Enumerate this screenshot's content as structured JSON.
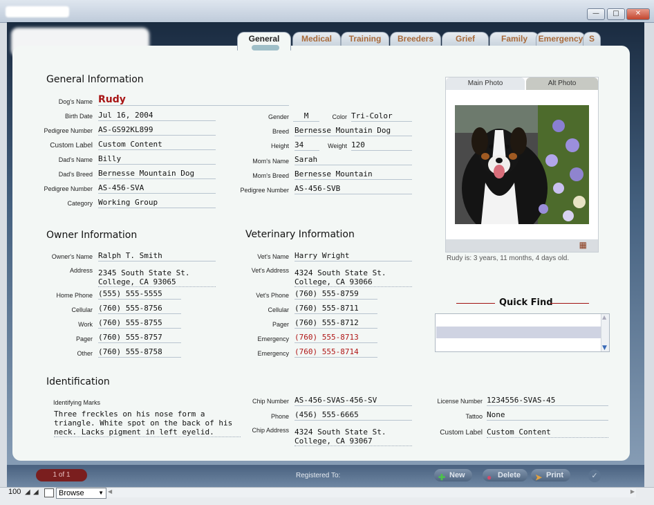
{
  "tabs": [
    "General",
    "Medical",
    "Training",
    "Breeders",
    "Grief",
    "Family",
    "Emergency",
    "S"
  ],
  "general": {
    "title": "General Information",
    "dog_name_label": "Dog's Name",
    "dog_name": "Rudy",
    "birth_date_label": "Birth Date",
    "birth_date": "Jul 16, 2004",
    "pedigree_label": "Pedigree Number",
    "pedigree": "AS-GS92KL899",
    "custom_label_label": "Custom Label",
    "custom_label": "Custom Content",
    "dads_name_label": "Dad's Name",
    "dads_name": "Billy",
    "dads_breed_label": "Dad's Breed",
    "dads_breed": "Bernesse Mountain Dog",
    "dad_pedigree_label": "Pedigree Number",
    "dad_pedigree": "AS-456-SVA",
    "category_label": "Category",
    "category": "Working Group",
    "gender_label": "Gender",
    "gender": "M",
    "color_label": "Color",
    "color": "Tri-Color",
    "breed_label": "Breed",
    "breed": "Bernesse Mountain Dog",
    "height_label": "Height",
    "height": "34",
    "weight_label": "Weight",
    "weight": "120",
    "moms_name_label": "Mom's Name",
    "moms_name": "Sarah",
    "moms_breed_label": "Mom's Breed",
    "moms_breed": "Bernesse Mountain",
    "mom_pedigree_label": "Pedigree Number",
    "mom_pedigree": "AS-456-SVB"
  },
  "photo": {
    "main_tab": "Main Photo",
    "alt_tab": "Alt Photo",
    "age_text": "Rudy is: 3 years, 11 months, 4 days old."
  },
  "owner": {
    "title": "Owner Information",
    "name_label": "Owner's Name",
    "name": "Ralph T. Smith",
    "address_label": "Address",
    "address1": "2345 South State St.",
    "address2": "College, CA 93065",
    "home_label": "Home Phone",
    "home": "(555) 555-5555",
    "cell_label": "Cellular",
    "cell": "(760) 555-8756",
    "work_label": "Work",
    "work": "(760) 555-8755",
    "pager_label": "Pager",
    "pager": "(760) 555-8757",
    "other_label": "Other",
    "other": "(760) 555-8758"
  },
  "vet": {
    "title": "Veterinary Information",
    "name_label": "Vet's Name",
    "name": "Harry Wright",
    "address_label": "Vet's Address",
    "address1": "4324 South State St.",
    "address2": "College, CA 93066",
    "phone_label": "Vet's Phone",
    "phone": "(760) 555-8759",
    "cell_label": "Cellular",
    "cell": "(760) 555-8711",
    "pager_label": "Pager",
    "pager": "(760) 555-8712",
    "emergency_label": "Emergency",
    "emergency1": "(760) 555-8713",
    "emergency2": "(760) 555-8714"
  },
  "quickfind": {
    "title": "Quick Find"
  },
  "identification": {
    "title": "Identification",
    "marks_label": "Identifying Marks",
    "marks": "Three freckles on his nose form a triangle. White spot on the back of his neck. Lacks pigment in left eyelid.",
    "chip_label": "Chip Number",
    "chip": "AS-456-SVAS-456-SV",
    "phone_label": "Phone",
    "phone": "(456) 555-6665",
    "chip_address_label": "Chip Address",
    "chip_address1": "4324 South State St.",
    "chip_address2": "College, CA 93067",
    "license_label": "License Number",
    "license": "1234556-SVAS-45",
    "tattoo_label": "Tattoo",
    "tattoo": "None",
    "custom_label_label": "Custom Label",
    "custom_label": "Custom Content"
  },
  "status": {
    "record": "1 of 1",
    "registered": "Registered To:",
    "new": "New",
    "delete": "Delete",
    "print": "Print"
  },
  "bottom": {
    "zoom": "100",
    "mode": "Browse"
  }
}
